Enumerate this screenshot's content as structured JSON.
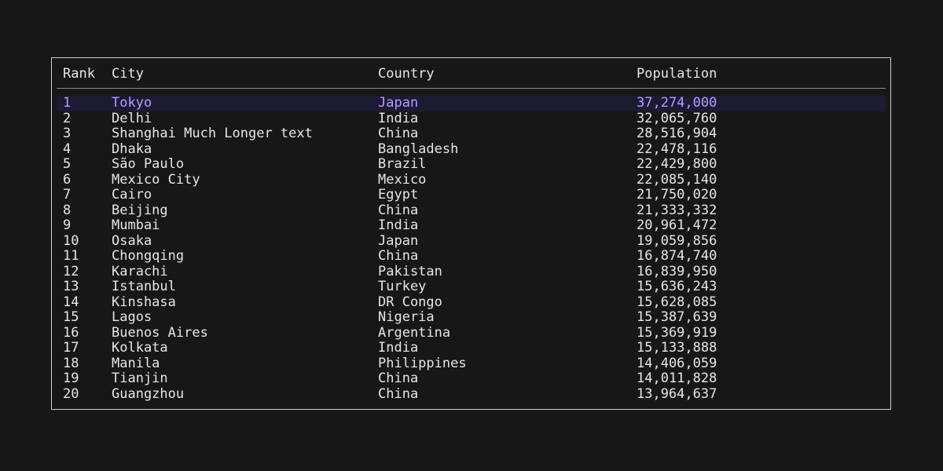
{
  "table": {
    "columns": [
      "Rank",
      "City",
      "Country",
      "Population"
    ],
    "selected_index": 0,
    "rows": [
      {
        "rank": "1",
        "city": "Tokyo",
        "country": "Japan",
        "population": "37,274,000"
      },
      {
        "rank": "2",
        "city": "Delhi",
        "country": "India",
        "population": "32,065,760"
      },
      {
        "rank": "3",
        "city": "Shanghai Much Longer text",
        "country": "China",
        "population": "28,516,904"
      },
      {
        "rank": "4",
        "city": "Dhaka",
        "country": "Bangladesh",
        "population": "22,478,116"
      },
      {
        "rank": "5",
        "city": "São Paulo",
        "country": "Brazil",
        "population": "22,429,800"
      },
      {
        "rank": "6",
        "city": "Mexico City",
        "country": "Mexico",
        "population": "22,085,140"
      },
      {
        "rank": "7",
        "city": "Cairo",
        "country": "Egypt",
        "population": "21,750,020"
      },
      {
        "rank": "8",
        "city": "Beijing",
        "country": "China",
        "population": "21,333,332"
      },
      {
        "rank": "9",
        "city": "Mumbai",
        "country": "India",
        "population": "20,961,472"
      },
      {
        "rank": "10",
        "city": "Osaka",
        "country": "Japan",
        "population": "19,059,856"
      },
      {
        "rank": "11",
        "city": "Chongqing",
        "country": "China",
        "population": "16,874,740"
      },
      {
        "rank": "12",
        "city": "Karachi",
        "country": "Pakistan",
        "population": "16,839,950"
      },
      {
        "rank": "13",
        "city": "Istanbul",
        "country": "Turkey",
        "population": "15,636,243"
      },
      {
        "rank": "14",
        "city": "Kinshasa",
        "country": "DR Congo",
        "population": "15,628,085"
      },
      {
        "rank": "15",
        "city": "Lagos",
        "country": "Nigeria",
        "population": "15,387,639"
      },
      {
        "rank": "16",
        "city": "Buenos Aires",
        "country": "Argentina",
        "population": "15,369,919"
      },
      {
        "rank": "17",
        "city": "Kolkata",
        "country": "India",
        "population": "15,133,888"
      },
      {
        "rank": "18",
        "city": "Manila",
        "country": "Philippines",
        "population": "14,406,059"
      },
      {
        "rank": "19",
        "city": "Tianjin",
        "country": "China",
        "population": "14,011,828"
      },
      {
        "rank": "20",
        "city": "Guangzhou",
        "country": "China",
        "population": "13,964,637"
      }
    ]
  },
  "colors": {
    "background": "#171717",
    "text": "#e6e6e6",
    "border": "#cfcfcf",
    "selected_text": "#b79cff",
    "selected_background": "#1d1a34"
  }
}
